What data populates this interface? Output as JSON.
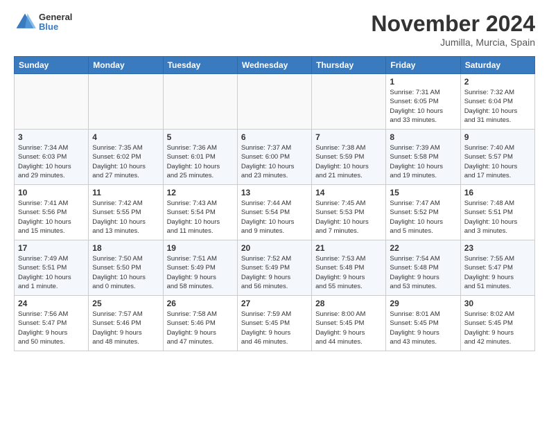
{
  "header": {
    "logo_line1": "General",
    "logo_line2": "Blue",
    "month": "November 2024",
    "location": "Jumilla, Murcia, Spain"
  },
  "weekdays": [
    "Sunday",
    "Monday",
    "Tuesday",
    "Wednesday",
    "Thursday",
    "Friday",
    "Saturday"
  ],
  "weeks": [
    [
      {
        "day": "",
        "info": ""
      },
      {
        "day": "",
        "info": ""
      },
      {
        "day": "",
        "info": ""
      },
      {
        "day": "",
        "info": ""
      },
      {
        "day": "",
        "info": ""
      },
      {
        "day": "1",
        "info": "Sunrise: 7:31 AM\nSunset: 6:05 PM\nDaylight: 10 hours\nand 33 minutes."
      },
      {
        "day": "2",
        "info": "Sunrise: 7:32 AM\nSunset: 6:04 PM\nDaylight: 10 hours\nand 31 minutes."
      }
    ],
    [
      {
        "day": "3",
        "info": "Sunrise: 7:34 AM\nSunset: 6:03 PM\nDaylight: 10 hours\nand 29 minutes."
      },
      {
        "day": "4",
        "info": "Sunrise: 7:35 AM\nSunset: 6:02 PM\nDaylight: 10 hours\nand 27 minutes."
      },
      {
        "day": "5",
        "info": "Sunrise: 7:36 AM\nSunset: 6:01 PM\nDaylight: 10 hours\nand 25 minutes."
      },
      {
        "day": "6",
        "info": "Sunrise: 7:37 AM\nSunset: 6:00 PM\nDaylight: 10 hours\nand 23 minutes."
      },
      {
        "day": "7",
        "info": "Sunrise: 7:38 AM\nSunset: 5:59 PM\nDaylight: 10 hours\nand 21 minutes."
      },
      {
        "day": "8",
        "info": "Sunrise: 7:39 AM\nSunset: 5:58 PM\nDaylight: 10 hours\nand 19 minutes."
      },
      {
        "day": "9",
        "info": "Sunrise: 7:40 AM\nSunset: 5:57 PM\nDaylight: 10 hours\nand 17 minutes."
      }
    ],
    [
      {
        "day": "10",
        "info": "Sunrise: 7:41 AM\nSunset: 5:56 PM\nDaylight: 10 hours\nand 15 minutes."
      },
      {
        "day": "11",
        "info": "Sunrise: 7:42 AM\nSunset: 5:55 PM\nDaylight: 10 hours\nand 13 minutes."
      },
      {
        "day": "12",
        "info": "Sunrise: 7:43 AM\nSunset: 5:54 PM\nDaylight: 10 hours\nand 11 minutes."
      },
      {
        "day": "13",
        "info": "Sunrise: 7:44 AM\nSunset: 5:54 PM\nDaylight: 10 hours\nand 9 minutes."
      },
      {
        "day": "14",
        "info": "Sunrise: 7:45 AM\nSunset: 5:53 PM\nDaylight: 10 hours\nand 7 minutes."
      },
      {
        "day": "15",
        "info": "Sunrise: 7:47 AM\nSunset: 5:52 PM\nDaylight: 10 hours\nand 5 minutes."
      },
      {
        "day": "16",
        "info": "Sunrise: 7:48 AM\nSunset: 5:51 PM\nDaylight: 10 hours\nand 3 minutes."
      }
    ],
    [
      {
        "day": "17",
        "info": "Sunrise: 7:49 AM\nSunset: 5:51 PM\nDaylight: 10 hours\nand 1 minute."
      },
      {
        "day": "18",
        "info": "Sunrise: 7:50 AM\nSunset: 5:50 PM\nDaylight: 10 hours\nand 0 minutes."
      },
      {
        "day": "19",
        "info": "Sunrise: 7:51 AM\nSunset: 5:49 PM\nDaylight: 9 hours\nand 58 minutes."
      },
      {
        "day": "20",
        "info": "Sunrise: 7:52 AM\nSunset: 5:49 PM\nDaylight: 9 hours\nand 56 minutes."
      },
      {
        "day": "21",
        "info": "Sunrise: 7:53 AM\nSunset: 5:48 PM\nDaylight: 9 hours\nand 55 minutes."
      },
      {
        "day": "22",
        "info": "Sunrise: 7:54 AM\nSunset: 5:48 PM\nDaylight: 9 hours\nand 53 minutes."
      },
      {
        "day": "23",
        "info": "Sunrise: 7:55 AM\nSunset: 5:47 PM\nDaylight: 9 hours\nand 51 minutes."
      }
    ],
    [
      {
        "day": "24",
        "info": "Sunrise: 7:56 AM\nSunset: 5:47 PM\nDaylight: 9 hours\nand 50 minutes."
      },
      {
        "day": "25",
        "info": "Sunrise: 7:57 AM\nSunset: 5:46 PM\nDaylight: 9 hours\nand 48 minutes."
      },
      {
        "day": "26",
        "info": "Sunrise: 7:58 AM\nSunset: 5:46 PM\nDaylight: 9 hours\nand 47 minutes."
      },
      {
        "day": "27",
        "info": "Sunrise: 7:59 AM\nSunset: 5:45 PM\nDaylight: 9 hours\nand 46 minutes."
      },
      {
        "day": "28",
        "info": "Sunrise: 8:00 AM\nSunset: 5:45 PM\nDaylight: 9 hours\nand 44 minutes."
      },
      {
        "day": "29",
        "info": "Sunrise: 8:01 AM\nSunset: 5:45 PM\nDaylight: 9 hours\nand 43 minutes."
      },
      {
        "day": "30",
        "info": "Sunrise: 8:02 AM\nSunset: 5:45 PM\nDaylight: 9 hours\nand 42 minutes."
      }
    ]
  ]
}
